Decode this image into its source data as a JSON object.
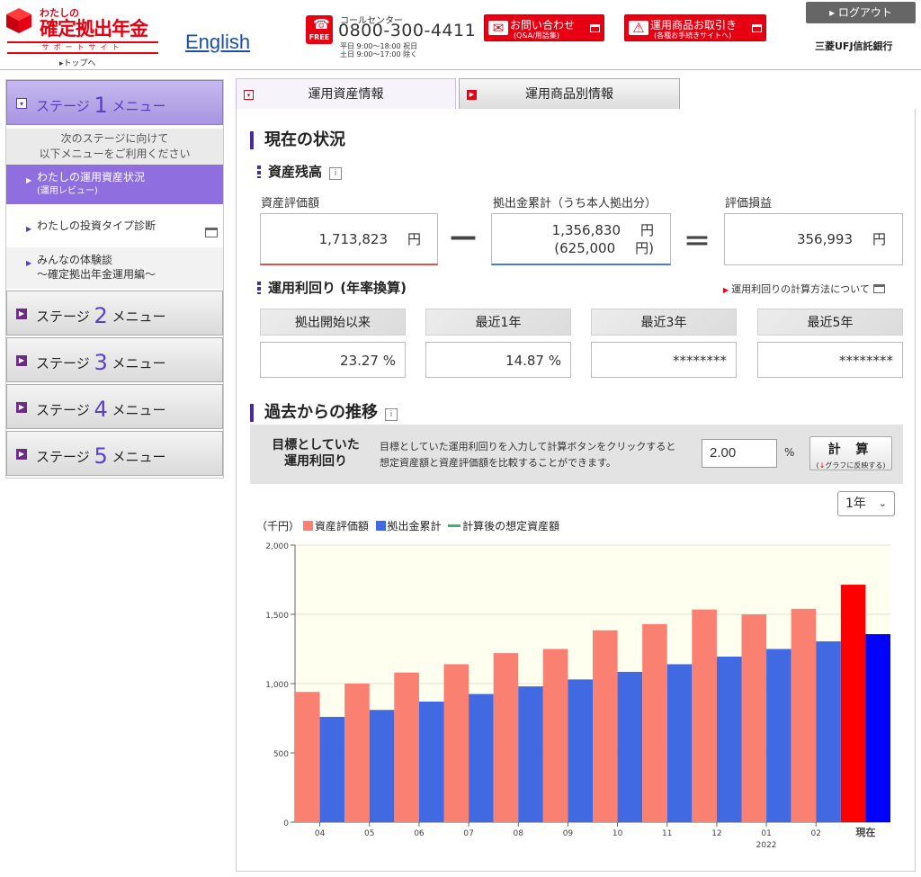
{
  "header": {
    "logo_small": "わたしの",
    "logo_main": "確定拠出年金",
    "logo_support": "サポートサイト",
    "logo_top_link": "トップへ",
    "english_link": "English",
    "call_label": "コールセンター",
    "call_free": "FREE",
    "call_number": "0800-300-4411",
    "call_hours_1": "平日 9:00～18:00  祝日",
    "call_hours_2": "土日 9:00～17:00  除く",
    "contact_label": "お問い合わせ",
    "contact_sub": "(Q&A/用語集)",
    "product_label": "運用商品お取引き",
    "product_sub": "(各種お手続きサイトへ)",
    "logout_label": "ログアウト",
    "bank_name": "三菱UFJ信託銀行"
  },
  "sidebar": {
    "stages": [
      {
        "prefix": "ステージ",
        "num": "1",
        "suffix": "メニュー"
      },
      {
        "prefix": "ステージ",
        "num": "2",
        "suffix": "メニュー"
      },
      {
        "prefix": "ステージ",
        "num": "3",
        "suffix": "メニュー"
      },
      {
        "prefix": "ステージ",
        "num": "4",
        "suffix": "メニュー"
      },
      {
        "prefix": "ステージ",
        "num": "5",
        "suffix": "メニュー"
      }
    ],
    "note_1": "次のステージに向けて",
    "note_2": "以下メニューをご利用ください",
    "item1_label": "わたしの運用資産状況",
    "item1_sub": "(運用レビュー)",
    "item2_label": "わたしの投資タイプ診断",
    "item3_label": "みんなの体験談",
    "item3_sub": "～確定拠出年金運用編～"
  },
  "tabs": {
    "tab1": "運用資産情報",
    "tab2": "運用商品別情報"
  },
  "main": {
    "section1_title": "現在の状況",
    "balance_title": "資産残高",
    "info_icon": "i",
    "asset_label": "資産評価額",
    "asset_value": "1,713,823",
    "contrib_label": "拠出金累計（うち本人拠出分）",
    "contrib_value": "1,356,830",
    "contrib_self": "(625,000",
    "gain_label": "評価損益",
    "gain_value": "356,993",
    "yen": "円",
    "yen_close": "円)",
    "minus": "—",
    "equals": "＝",
    "yield_title": "運用利回り (年率換算)",
    "calc_link": "運用利回りの計算方法について",
    "yields": [
      {
        "label": "拠出開始以来",
        "value": "23.27 %"
      },
      {
        "label": "最近1年",
        "value": "14.87 %"
      },
      {
        "label": "最近3年",
        "value": "********"
      },
      {
        "label": "最近5年",
        "value": "********"
      }
    ],
    "section2_title": "過去からの推移",
    "target_label_1": "目標としていた",
    "target_label_2": "運用利回り",
    "target_desc_1": "目標としていた運用利回りを入力して計算ボタンをクリックすると",
    "target_desc_2": "想定資産額と資産評価額を比較することができます。",
    "target_value": "2.00",
    "pct": "%",
    "calc_btn": "計 算",
    "calc_btn_sub_arrow": "↓",
    "calc_btn_sub": "グラフに反映する)",
    "calc_btn_sub_open": "(",
    "period_value": "1年",
    "legend_unit": "（千円）",
    "legend_asset": "資産評価額",
    "legend_contrib": "拠出金累計",
    "legend_projected": "計算後の想定資産額"
  },
  "colors": {
    "asset": "#fa8072",
    "contrib": "#4169e1",
    "asset_now": "#ff0000",
    "contrib_now": "#0000ff",
    "projected": "#3cb371",
    "plot_bg": "#fffff0",
    "accent_purple": "#5a3bc0",
    "brand_red": "#e60012"
  },
  "chart_data": {
    "type": "bar",
    "categories": [
      "04",
      "05",
      "06",
      "07",
      "08",
      "09",
      "10",
      "11",
      "12",
      "01",
      "02",
      "現在"
    ],
    "year_label": "2022",
    "year_under": "01",
    "series": [
      {
        "name": "資産評価額",
        "values": [
          940,
          1000,
          1080,
          1140,
          1220,
          1250,
          1385,
          1430,
          1535,
          1500,
          1540,
          1714
        ]
      },
      {
        "name": "拠出金累計",
        "values": [
          760,
          810,
          870,
          925,
          980,
          1030,
          1085,
          1140,
          1195,
          1250,
          1305,
          1357
        ]
      }
    ],
    "ylabel": "（千円）",
    "ylim": [
      0,
      2000
    ],
    "yticks": [
      "0",
      "500",
      "1,000",
      "1,500",
      "2,000"
    ],
    "ytick_values": [
      0,
      500,
      1000,
      1500,
      2000
    ],
    "grid": true,
    "legend": "top-left"
  }
}
